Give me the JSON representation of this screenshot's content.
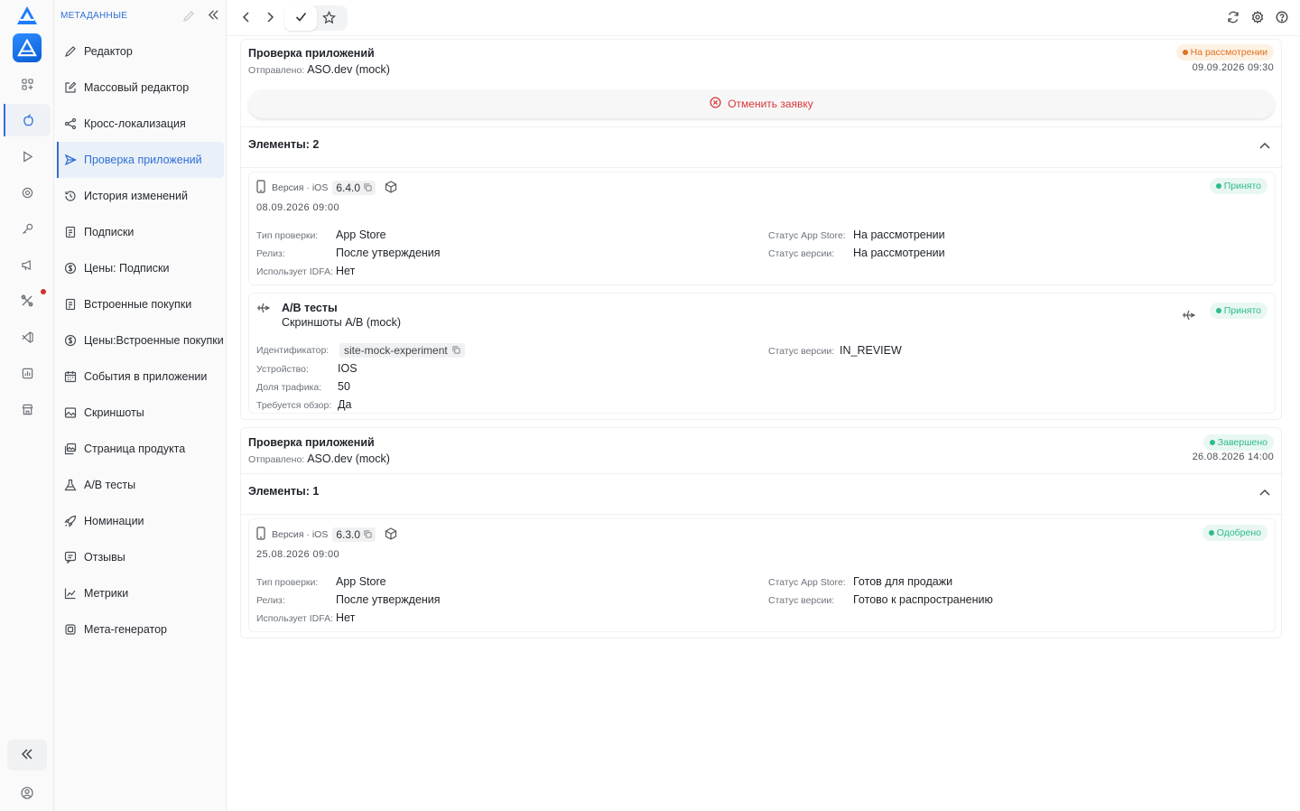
{
  "colors": {
    "accent": "#2f6fd6",
    "danger": "#d93838",
    "warning": "#e0711d",
    "success": "#2ebb8a"
  },
  "rail": {
    "icons": [
      "logo-icon",
      "app-icon",
      "grid-icon",
      "apple-icon",
      "play-icon",
      "target-icon",
      "key-icon",
      "megaphone-icon",
      "tools-icon",
      "vscode-icon",
      "chart-icon",
      "store-icon"
    ],
    "collapse_icon": "double-chevron-left-icon",
    "user_icon": "user-circle-icon"
  },
  "sidebar": {
    "header": "МЕТАДАННЫЕ",
    "items": [
      {
        "label": "Редактор",
        "icon": "pencil-icon"
      },
      {
        "label": "Массовый редактор",
        "icon": "edit-box-icon"
      },
      {
        "label": "Кросс-локализация",
        "icon": "share-icon"
      },
      {
        "label": "Проверка приложений",
        "icon": "send-icon",
        "active": true
      },
      {
        "label": "История изменений",
        "icon": "history-icon"
      },
      {
        "label": "Подписки",
        "icon": "receipt-icon"
      },
      {
        "label": "Цены: Подписки",
        "icon": "dollar-icon"
      },
      {
        "label": "Встроенные покупки",
        "icon": "receipt-icon"
      },
      {
        "label": "Цены:Встроенные покупки",
        "icon": "dollar-icon"
      },
      {
        "label": "События в приложении",
        "icon": "calendar-icon"
      },
      {
        "label": "Скриншоты",
        "icon": "image-icon"
      },
      {
        "label": "Страница продукта",
        "icon": "gallery-icon"
      },
      {
        "label": "A/B тесты",
        "icon": "flask-icon"
      },
      {
        "label": "Номинации",
        "icon": "rocket-icon"
      },
      {
        "label": "Отзывы",
        "icon": "review-icon"
      },
      {
        "label": "Метрики",
        "icon": "metrics-icon"
      },
      {
        "label": "Мета-генератор",
        "icon": "chip-icon"
      }
    ]
  },
  "submissions": [
    {
      "title": "Проверка приложений",
      "sent_label": "Отправлено:",
      "sent_by": "ASO.dev (mock)",
      "status": "На рассмотрении",
      "timestamp": "09.09.2026 09:30",
      "cancel_label": "Отменить заявку",
      "elements_label": "Элементы: 2",
      "version": {
        "label": "Версия · iOS",
        "number": "6.4.0",
        "date": "08.09.2026 09:00",
        "status": "Принято",
        "check_type_label": "Тип проверки:",
        "check_type": "App Store",
        "release_label": "Релиз:",
        "release": "После утверждения",
        "idfa_label": "Использует IDFA:",
        "idfa": "Нет",
        "store_status_label": "Статус App Store:",
        "store_status": "На рассмотрении",
        "version_status_label": "Статус версии:",
        "version_status": "На рассмотрении"
      },
      "ab_test": {
        "title": "A/B тесты",
        "subtitle": "Скриншоты A/B (mock)",
        "status": "Принято",
        "id_label": "Идентификатор:",
        "id": "site-mock-experiment",
        "device_label": "Устройство:",
        "device": "IOS",
        "traffic_label": "Доля трафика:",
        "traffic": "50",
        "review_label": "Требуется обзор:",
        "review": "Да",
        "version_status_label": "Статус версии:",
        "version_status": "IN_REVIEW"
      }
    },
    {
      "title": "Проверка приложений",
      "sent_label": "Отправлено:",
      "sent_by": "ASO.dev (mock)",
      "status": "Завершено",
      "timestamp": "26.08.2026 14:00",
      "elements_label": "Элементы: 1",
      "version": {
        "label": "Версия · iOS",
        "number": "6.3.0",
        "date": "25.08.2026 09:00",
        "status": "Одобрено",
        "check_type_label": "Тип проверки:",
        "check_type": "App Store",
        "release_label": "Релиз:",
        "release": "После утверждения",
        "idfa_label": "Использует IDFA:",
        "idfa": "Нет",
        "store_status_label": "Статус App Store:",
        "store_status": "Готов для продажи",
        "version_status_label": "Статус версии:",
        "version_status": "Готово к распространению"
      }
    }
  ]
}
